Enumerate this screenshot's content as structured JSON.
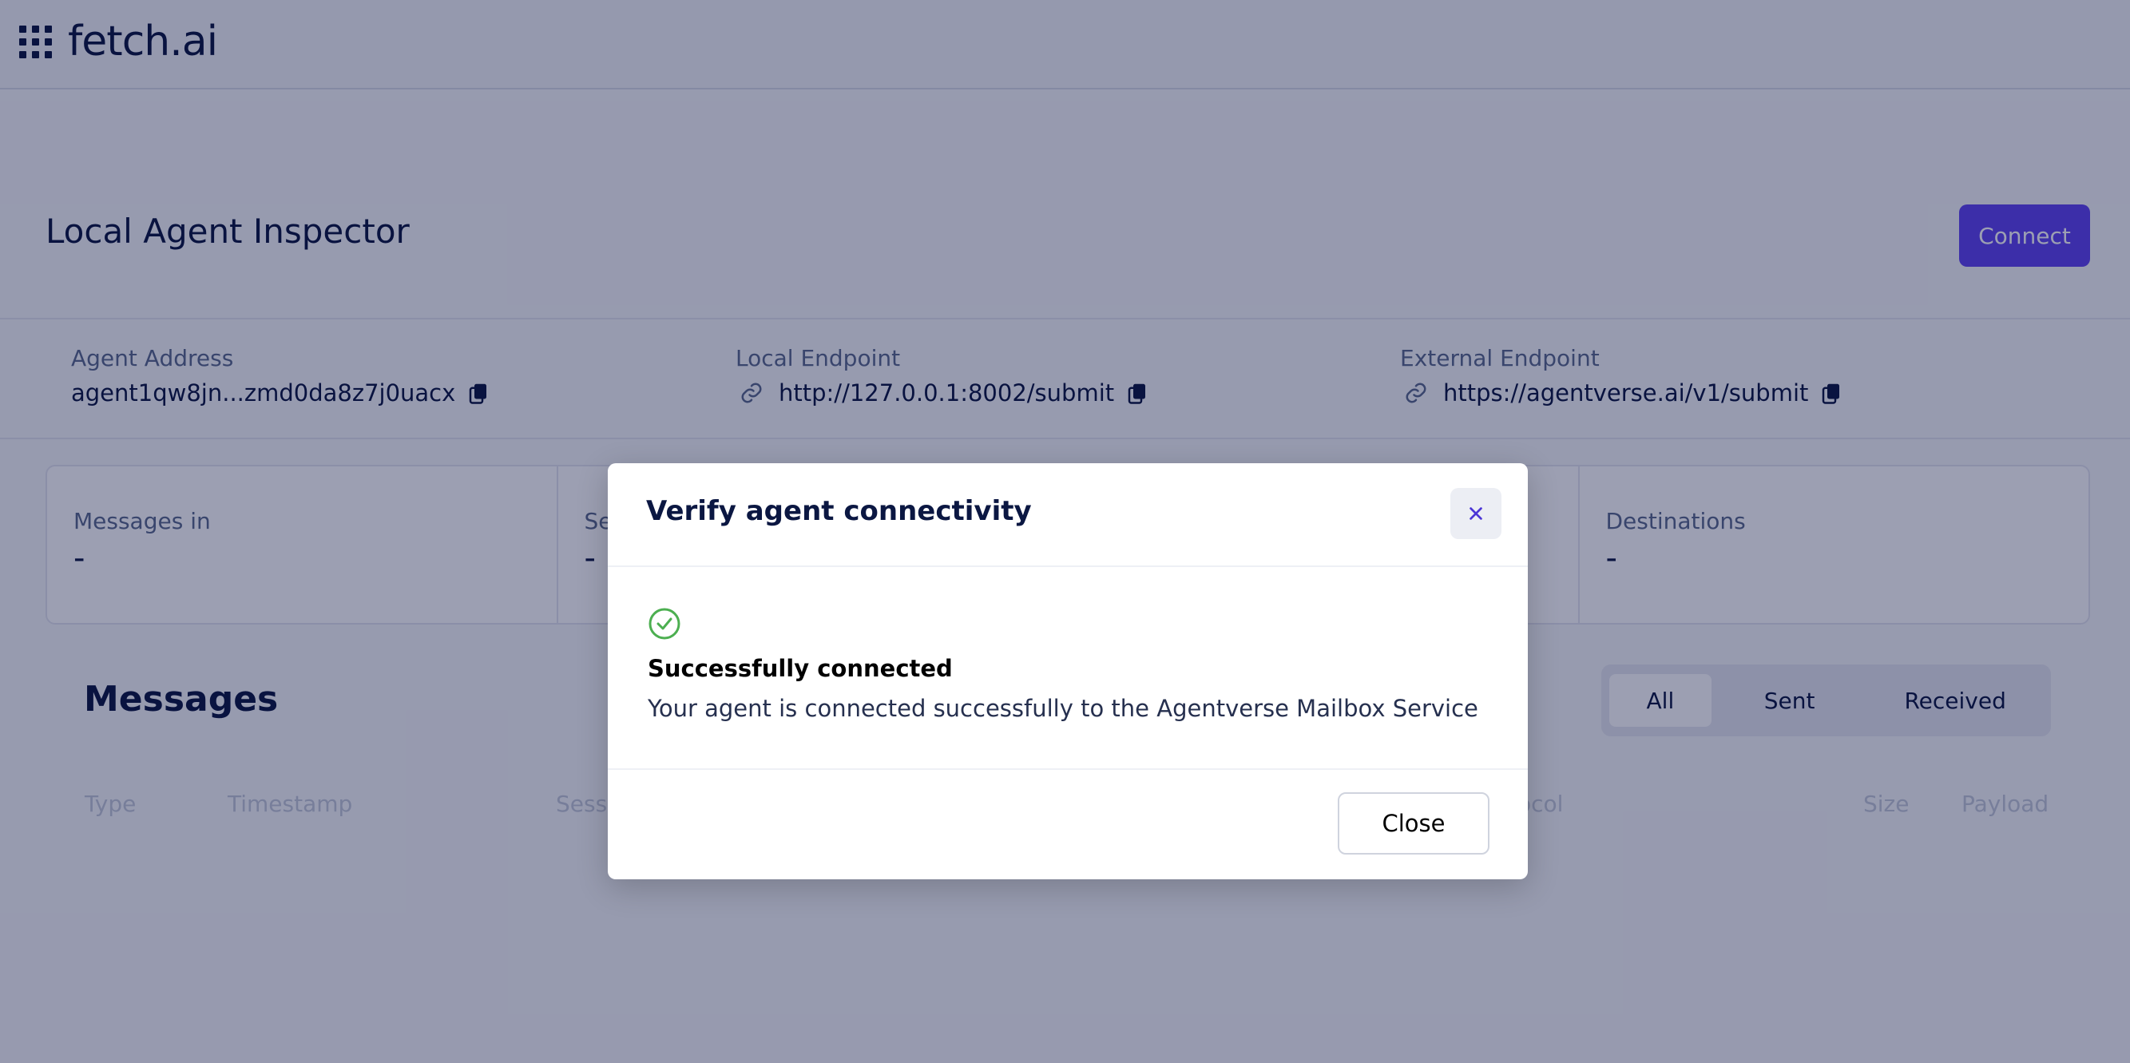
{
  "header": {
    "brand": "fetch.ai"
  },
  "page": {
    "title": "Local Agent Inspector",
    "connect_label": "Connect"
  },
  "info": {
    "agent_address": {
      "label": "Agent Address",
      "value": "agent1qw8jn...zmd0da8z7j0uacx"
    },
    "local_endpoint": {
      "label": "Local Endpoint",
      "value": "http://127.0.0.1:8002/submit"
    },
    "external_endpoint": {
      "label": "External Endpoint",
      "value": "https://agentverse.ai/v1/submit"
    }
  },
  "stats": [
    {
      "label": "Messages in",
      "value": "-"
    },
    {
      "label": "Se",
      "value": "-"
    },
    {
      "label": "",
      "value": ""
    },
    {
      "label": "Destinations",
      "value": "-"
    }
  ],
  "messages": {
    "title": "Messages",
    "filters": [
      "All",
      "Sent",
      "Received"
    ],
    "active_filter": "All",
    "columns": [
      "Type",
      "Timestamp",
      "Sessi",
      "ocol",
      "Size",
      "Payload"
    ]
  },
  "modal": {
    "title": "Verify agent connectivity",
    "status_title": "Successfully connected",
    "status_text": "Your agent is connected successfully to the Agentverse Mailbox Service",
    "close_label": "Close"
  },
  "colors": {
    "accent": "#5f43f1",
    "success": "#4caf50",
    "text": "#0b1742"
  }
}
